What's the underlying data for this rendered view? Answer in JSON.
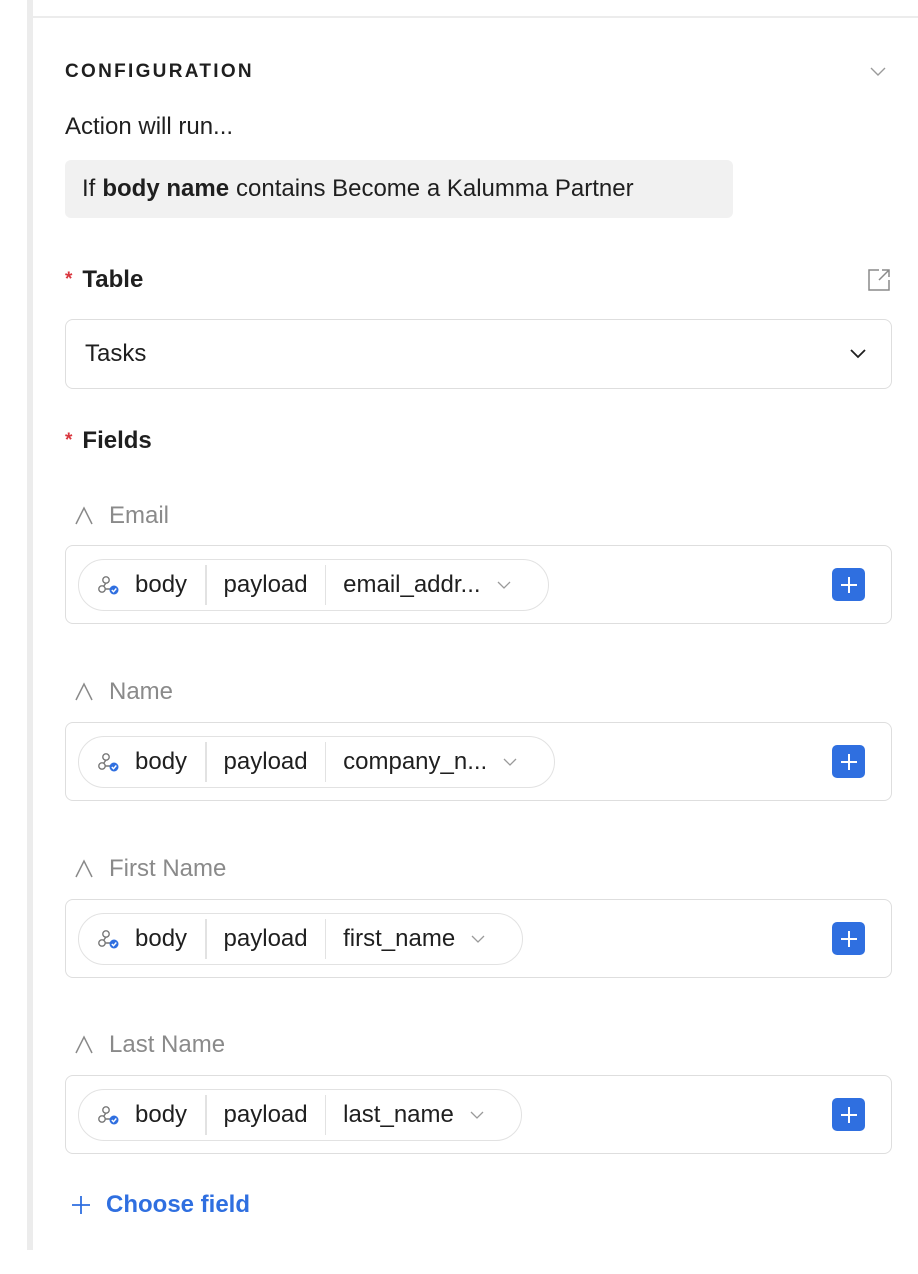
{
  "configuration": {
    "section_title": "CONFIGURATION",
    "action_runs_label": "Action will run...",
    "condition": {
      "prefix": "If",
      "field": "body name",
      "operator_value": "contains Become a Kalumma Partner"
    }
  },
  "table": {
    "required_mark": "*",
    "label": "Table",
    "selected": "Tasks"
  },
  "fields_section": {
    "required_mark": "*",
    "label": "Fields",
    "fields": [
      {
        "label": "Email",
        "source": "body",
        "path": "payload",
        "value": "email_addr..."
      },
      {
        "label": "Name",
        "source": "body",
        "path": "payload",
        "value": "company_n..."
      },
      {
        "label": "First Name",
        "source": "body",
        "path": "payload",
        "value": "first_name"
      },
      {
        "label": "Last Name",
        "source": "body",
        "path": "payload",
        "value": "last_name"
      }
    ],
    "choose_field_label": "Choose field"
  },
  "colors": {
    "accent": "#2f6fe0",
    "required": "#d9363e",
    "muted_label": "#8a8a8a",
    "condition_bg": "#f1f1f1",
    "border": "#dedede"
  },
  "icons": {
    "collapse": "chevron-down-icon",
    "external": "external-link-icon",
    "table_select": "chevron-down-icon",
    "field_type": "text-type-icon",
    "field_source": "webhook-icon",
    "field_dropdown": "chevron-down-icon",
    "field_add": "plus-square-icon",
    "choose_field": "plus-icon"
  }
}
